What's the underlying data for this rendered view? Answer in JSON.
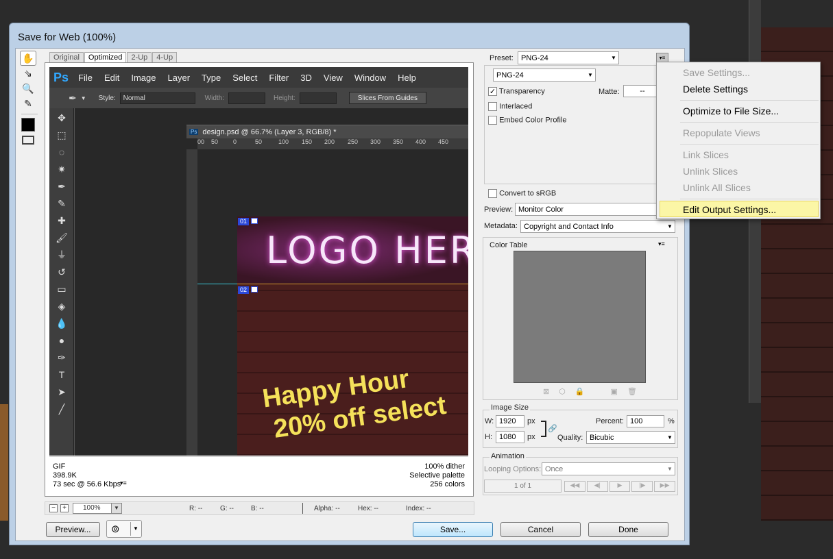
{
  "dialog": {
    "title": "Save for Web (100%)"
  },
  "tabs": [
    "Original",
    "Optimized",
    "2-Up",
    "4-Up"
  ],
  "photoshop": {
    "logo": "Ps",
    "menus": [
      "File",
      "Edit",
      "Image",
      "Layer",
      "Type",
      "Select",
      "Filter",
      "3D",
      "View",
      "Window",
      "Help"
    ],
    "options": {
      "style_label": "Style:",
      "style_value": "Normal",
      "width_label": "Width:",
      "height_label": "Height:",
      "slices_button": "Slices From Guides"
    },
    "doc_title": "design.psd @ 66.7% (Layer 3, RGB/8) *",
    "ruler_ticks": [
      "00",
      "50",
      "0",
      "50",
      "100",
      "150",
      "200",
      "250",
      "300",
      "350",
      "400",
      "450"
    ],
    "slice_tags": [
      "01",
      "02"
    ],
    "artwork": {
      "logo_text": "LOGO HER",
      "line1": "Happy Hour",
      "line2": "20% off select"
    }
  },
  "info": {
    "format": "GIF",
    "size": "398.9K",
    "speed": "73 sec @ 56.6 Kbps",
    "dither": "100% dither",
    "palette": "Selective palette",
    "colors": "256 colors"
  },
  "status": {
    "zoom": "100%",
    "r": "R: --",
    "g": "G: --",
    "b": "B: --",
    "alpha": "Alpha: --",
    "hex": "Hex: --",
    "index": "Index: --"
  },
  "buttons": {
    "preview": "Preview...",
    "save": "Save...",
    "cancel": "Cancel",
    "done": "Done"
  },
  "settings": {
    "preset_label": "Preset:",
    "preset_value": "PNG-24",
    "format_value": "PNG-24",
    "transparency": "Transparency",
    "interlaced": "Interlaced",
    "embed_profile": "Embed Color Profile",
    "matte_label": "Matte:",
    "matte_value": "--",
    "convert_srgb": "Convert to sRGB",
    "preview_label": "Preview:",
    "preview_value": "Monitor Color",
    "metadata_label": "Metadata:",
    "metadata_value": "Copyright and Contact Info"
  },
  "color_table": {
    "title": "Color Table"
  },
  "image_size": {
    "title": "Image Size",
    "w_label": "W:",
    "w_value": "1920",
    "h_label": "H:",
    "h_value": "1080",
    "unit": "px",
    "percent_label": "Percent:",
    "percent_value": "100",
    "percent_unit": "%",
    "quality_label": "Quality:",
    "quality_value": "Bicubic"
  },
  "animation": {
    "title": "Animation",
    "looping_label": "Looping Options:",
    "looping_value": "Once",
    "frame": "1 of 1"
  },
  "menu": {
    "items": [
      {
        "label": "Save Settings...",
        "enabled": false
      },
      {
        "label": "Delete Settings",
        "enabled": true
      },
      {
        "label": "Optimize to File Size...",
        "enabled": true
      },
      {
        "label": "Repopulate Views",
        "enabled": false
      },
      {
        "label": "Link Slices",
        "enabled": false
      },
      {
        "label": "Unlink Slices",
        "enabled": false
      },
      {
        "label": "Unlink All Slices",
        "enabled": false
      },
      {
        "label": "Edit Output Settings...",
        "enabled": true,
        "highlighted": true
      }
    ]
  },
  "colors": {
    "highlight": "#fbf6a6",
    "dialog_frame": "#bcd0e6",
    "slice_tag": "#2b48d8",
    "happy_hour_text": "#f5e15a"
  }
}
